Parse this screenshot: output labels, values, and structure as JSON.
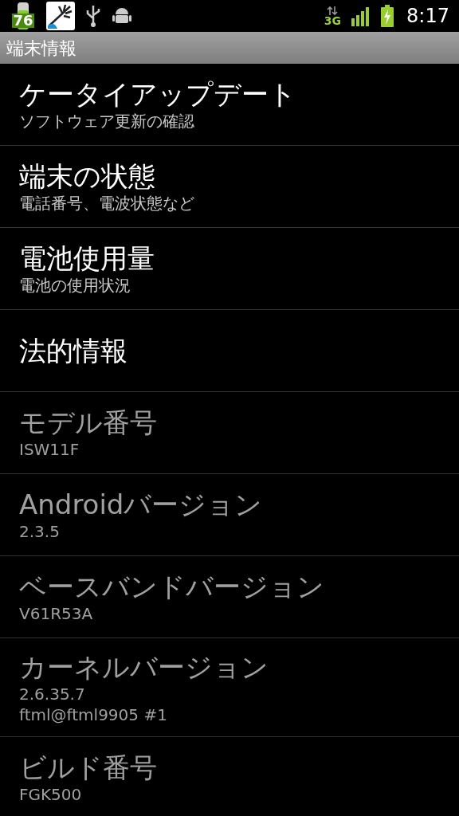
{
  "status_bar": {
    "battery_percent": "76",
    "network": "3G",
    "time": "8:17"
  },
  "title_bar": {
    "title": "端末情報"
  },
  "items": [
    {
      "title": "ケータイアップデート",
      "summary": [
        "ソフトウェア更新の確認"
      ],
      "disabled": false
    },
    {
      "title": "端末の状態",
      "summary": [
        "電話番号、電波状態など"
      ],
      "disabled": false
    },
    {
      "title": "電池使用量",
      "summary": [
        "電池の使用状況"
      ],
      "disabled": false
    },
    {
      "title": "法的情報",
      "disabled": false
    },
    {
      "title": "モデル番号",
      "summary": [
        "ISW11F"
      ],
      "disabled": true
    },
    {
      "title": "Androidバージョン",
      "summary": [
        "2.3.5"
      ],
      "disabled": true
    },
    {
      "title": "ベースバンドバージョン",
      "summary": [
        "V61R53A"
      ],
      "disabled": true
    },
    {
      "title": "カーネルバージョン",
      "summary": [
        "2.6.35.7",
        "ftml@ftml9905 #1"
      ],
      "disabled": true
    },
    {
      "title": "ビルド番号",
      "summary": [
        "FGK500"
      ],
      "disabled": true
    }
  ]
}
